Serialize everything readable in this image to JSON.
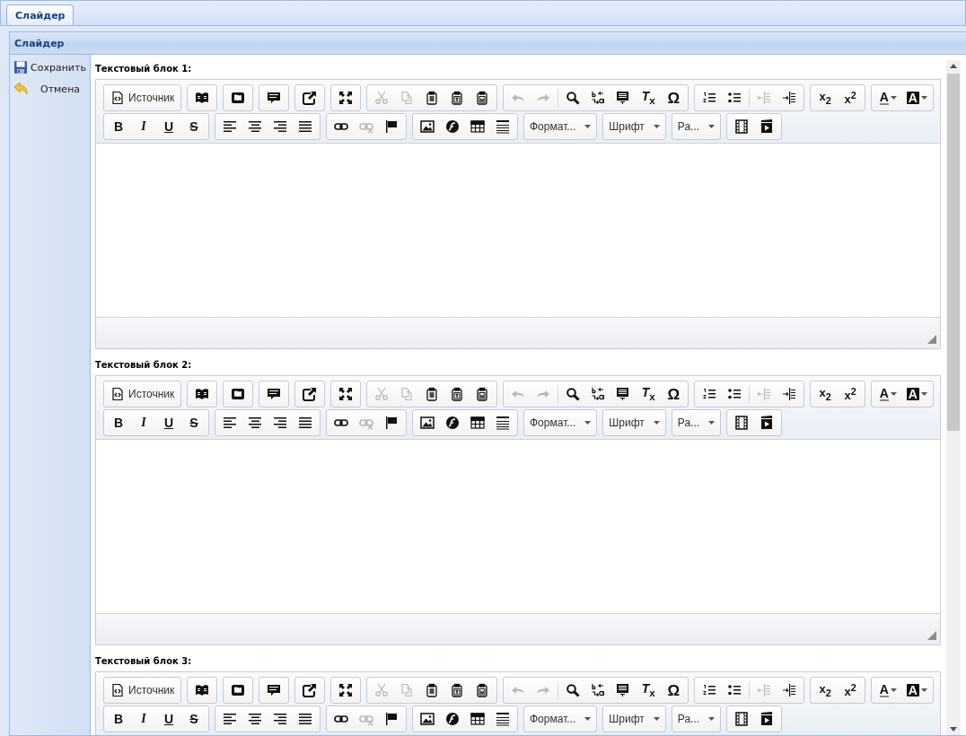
{
  "tabs": [
    {
      "label": "Слайдер",
      "selected": true
    }
  ],
  "panel": {
    "title": "Слайдер"
  },
  "actions": [
    {
      "kind": "save",
      "label": "Сохранить"
    },
    {
      "kind": "cancel",
      "label": "Отмена"
    }
  ],
  "editors": [
    {
      "label": "Текстовый блок 1:",
      "toolbar": [
        [
          {
            "sections": [
              [
                {
                  "kind": "source",
                  "disabled": false,
                  "label": "Источник"
                }
              ]
            ]
          },
          {
            "sections": [
              [
                {
                  "kind": "templates",
                  "disabled": false
                }
              ]
            ]
          },
          {
            "sections": [
              [
                {
                  "kind": "showblocks",
                  "disabled": false
                }
              ]
            ]
          },
          {
            "sections": [
              [
                {
                  "kind": "comment",
                  "disabled": false
                }
              ]
            ]
          },
          {
            "sections": [
              [
                {
                  "kind": "preview",
                  "disabled": false
                }
              ]
            ]
          },
          {
            "sections": [
              [
                {
                  "kind": "maximize",
                  "disabled": false
                }
              ]
            ]
          },
          {
            "sections": [
              [
                {
                  "kind": "cut",
                  "disabled": true
                },
                {
                  "kind": "copy",
                  "disabled": true
                },
                {
                  "kind": "paste",
                  "disabled": false
                },
                {
                  "kind": "pastetext",
                  "disabled": false
                },
                {
                  "kind": "pasteword",
                  "disabled": false
                }
              ]
            ]
          },
          {
            "sections": [
              [
                {
                  "kind": "undo",
                  "disabled": true
                },
                {
                  "kind": "redo",
                  "disabled": true
                }
              ],
              [
                {
                  "kind": "find",
                  "disabled": false
                },
                {
                  "kind": "replace",
                  "disabled": false
                },
                {
                  "kind": "selectall",
                  "disabled": false
                },
                {
                  "kind": "removeformat",
                  "disabled": false,
                  "label": "*T*$_{x}$"
                },
                {
                  "kind": "specialchar",
                  "disabled": false,
                  "label": "Ω"
                }
              ]
            ]
          },
          {
            "sections": [
              [
                {
                  "kind": "numlist",
                  "disabled": false
                },
                {
                  "kind": "bullist",
                  "disabled": false
                }
              ],
              [
                {
                  "kind": "outdent",
                  "disabled": true
                },
                {
                  "kind": "indent",
                  "disabled": false
                }
              ]
            ]
          },
          {
            "sections": [
              [
                {
                  "kind": "subscript",
                  "disabled": false,
                  "label": "x$_{2}$"
                },
                {
                  "kind": "superscript",
                  "disabled": false,
                  "label": "x$^{2}$"
                }
              ]
            ]
          },
          {
            "sections": [
              [
                {
                  "kind": "textcolor",
                  "disabled": false,
                  "label": "A"
                },
                {
                  "kind": "bgcolor",
                  "disabled": false,
                  "label": "A"
                }
              ]
            ]
          }
        ],
        [
          {
            "sections": [
              [
                {
                  "kind": "bold",
                  "disabled": false,
                  "label": "B"
                },
                {
                  "kind": "italic",
                  "disabled": false,
                  "label": "I"
                },
                {
                  "kind": "underline",
                  "disabled": false,
                  "label": "U"
                },
                {
                  "kind": "strike",
                  "disabled": false,
                  "label": "S"
                }
              ]
            ]
          },
          {
            "sections": [
              [
                {
                  "kind": "alignleft",
                  "disabled": false
                },
                {
                  "kind": "aligncenter",
                  "disabled": false
                },
                {
                  "kind": "alignright",
                  "disabled": false
                },
                {
                  "kind": "justify",
                  "disabled": false
                }
              ]
            ]
          },
          {
            "sections": [
              [
                {
                  "kind": "link",
                  "disabled": false
                },
                {
                  "kind": "unlink",
                  "disabled": true
                },
                {
                  "kind": "anchor",
                  "disabled": false
                }
              ]
            ]
          },
          {
            "sections": [
              [
                {
                  "kind": "image",
                  "disabled": false
                },
                {
                  "kind": "flash",
                  "disabled": false
                },
                {
                  "kind": "table",
                  "disabled": false
                },
                {
                  "kind": "hline",
                  "disabled": false
                }
              ]
            ]
          },
          {
            "sections": [
              [
                {
                  "kind": "combo",
                  "label": "Формат..."
                }
              ]
            ]
          },
          {
            "sections": [
              [
                {
                  "kind": "combo",
                  "label": "Шрифт"
                }
              ]
            ]
          },
          {
            "sections": [
              [
                {
                  "kind": "combo",
                  "label": "Ра..."
                }
              ]
            ]
          },
          {
            "sections": [
              [
                {
                  "kind": "film",
                  "disabled": false
                },
                {
                  "kind": "clapper",
                  "disabled": false
                }
              ]
            ]
          }
        ]
      ]
    },
    {
      "label": "Текстовый блок 2:",
      "toolbar": [
        [
          {
            "sections": [
              [
                {
                  "kind": "source",
                  "disabled": false,
                  "label": "Источник"
                }
              ]
            ]
          },
          {
            "sections": [
              [
                {
                  "kind": "templates",
                  "disabled": false
                }
              ]
            ]
          },
          {
            "sections": [
              [
                {
                  "kind": "showblocks",
                  "disabled": false
                }
              ]
            ]
          },
          {
            "sections": [
              [
                {
                  "kind": "comment",
                  "disabled": false
                }
              ]
            ]
          },
          {
            "sections": [
              [
                {
                  "kind": "preview",
                  "disabled": false
                }
              ]
            ]
          },
          {
            "sections": [
              [
                {
                  "kind": "maximize",
                  "disabled": false
                }
              ]
            ]
          },
          {
            "sections": [
              [
                {
                  "kind": "cut",
                  "disabled": true
                },
                {
                  "kind": "copy",
                  "disabled": true
                },
                {
                  "kind": "paste",
                  "disabled": false
                },
                {
                  "kind": "pastetext",
                  "disabled": false
                },
                {
                  "kind": "pasteword",
                  "disabled": false
                }
              ]
            ]
          },
          {
            "sections": [
              [
                {
                  "kind": "undo",
                  "disabled": true
                },
                {
                  "kind": "redo",
                  "disabled": true
                }
              ],
              [
                {
                  "kind": "find",
                  "disabled": false
                },
                {
                  "kind": "replace",
                  "disabled": false
                },
                {
                  "kind": "selectall",
                  "disabled": false
                },
                {
                  "kind": "removeformat",
                  "disabled": false,
                  "label": "*T*$_{x}$"
                },
                {
                  "kind": "specialchar",
                  "disabled": false,
                  "label": "Ω"
                }
              ]
            ]
          },
          {
            "sections": [
              [
                {
                  "kind": "numlist",
                  "disabled": false
                },
                {
                  "kind": "bullist",
                  "disabled": false
                }
              ],
              [
                {
                  "kind": "outdent",
                  "disabled": true
                },
                {
                  "kind": "indent",
                  "disabled": false
                }
              ]
            ]
          },
          {
            "sections": [
              [
                {
                  "kind": "subscript",
                  "disabled": false,
                  "label": "x$_{2}$"
                },
                {
                  "kind": "superscript",
                  "disabled": false,
                  "label": "x$^{2}$"
                }
              ]
            ]
          },
          {
            "sections": [
              [
                {
                  "kind": "textcolor",
                  "disabled": false,
                  "label": "A"
                },
                {
                  "kind": "bgcolor",
                  "disabled": false,
                  "label": "A"
                }
              ]
            ]
          }
        ],
        [
          {
            "sections": [
              [
                {
                  "kind": "bold",
                  "disabled": false,
                  "label": "B"
                },
                {
                  "kind": "italic",
                  "disabled": false,
                  "label": "I"
                },
                {
                  "kind": "underline",
                  "disabled": false,
                  "label": "U"
                },
                {
                  "kind": "strike",
                  "disabled": false,
                  "label": "S"
                }
              ]
            ]
          },
          {
            "sections": [
              [
                {
                  "kind": "alignleft",
                  "disabled": false
                },
                {
                  "kind": "aligncenter",
                  "disabled": false
                },
                {
                  "kind": "alignright",
                  "disabled": false
                },
                {
                  "kind": "justify",
                  "disabled": false
                }
              ]
            ]
          },
          {
            "sections": [
              [
                {
                  "kind": "link",
                  "disabled": false
                },
                {
                  "kind": "unlink",
                  "disabled": true
                },
                {
                  "kind": "anchor",
                  "disabled": false
                }
              ]
            ]
          },
          {
            "sections": [
              [
                {
                  "kind": "image",
                  "disabled": false
                },
                {
                  "kind": "flash",
                  "disabled": false
                },
                {
                  "kind": "table",
                  "disabled": false
                },
                {
                  "kind": "hline",
                  "disabled": false
                }
              ]
            ]
          },
          {
            "sections": [
              [
                {
                  "kind": "combo",
                  "label": "Формат..."
                }
              ]
            ]
          },
          {
            "sections": [
              [
                {
                  "kind": "combo",
                  "label": "Шрифт"
                }
              ]
            ]
          },
          {
            "sections": [
              [
                {
                  "kind": "combo",
                  "label": "Ра..."
                }
              ]
            ]
          },
          {
            "sections": [
              [
                {
                  "kind": "film",
                  "disabled": false
                },
                {
                  "kind": "clapper",
                  "disabled": false
                }
              ]
            ]
          }
        ]
      ]
    },
    {
      "label": "Текстовый блок 3:",
      "toolbar": [
        [
          {
            "sections": [
              [
                {
                  "kind": "source",
                  "disabled": false,
                  "label": "Источник"
                }
              ]
            ]
          },
          {
            "sections": [
              [
                {
                  "kind": "templates",
                  "disabled": false
                }
              ]
            ]
          },
          {
            "sections": [
              [
                {
                  "kind": "showblocks",
                  "disabled": false
                }
              ]
            ]
          },
          {
            "sections": [
              [
                {
                  "kind": "comment",
                  "disabled": false
                }
              ]
            ]
          },
          {
            "sections": [
              [
                {
                  "kind": "preview",
                  "disabled": false
                }
              ]
            ]
          },
          {
            "sections": [
              [
                {
                  "kind": "maximize",
                  "disabled": false
                }
              ]
            ]
          },
          {
            "sections": [
              [
                {
                  "kind": "cut",
                  "disabled": true
                },
                {
                  "kind": "copy",
                  "disabled": true
                },
                {
                  "kind": "paste",
                  "disabled": false
                },
                {
                  "kind": "pastetext",
                  "disabled": false
                },
                {
                  "kind": "pasteword",
                  "disabled": false
                }
              ]
            ]
          },
          {
            "sections": [
              [
                {
                  "kind": "undo",
                  "disabled": true
                },
                {
                  "kind": "redo",
                  "disabled": true
                }
              ],
              [
                {
                  "kind": "find",
                  "disabled": false
                },
                {
                  "kind": "replace",
                  "disabled": false
                },
                {
                  "kind": "selectall",
                  "disabled": false
                },
                {
                  "kind": "removeformat",
                  "disabled": false,
                  "label": "*T*$_{x}$"
                },
                {
                  "kind": "specialchar",
                  "disabled": false,
                  "label": "Ω"
                }
              ]
            ]
          },
          {
            "sections": [
              [
                {
                  "kind": "numlist",
                  "disabled": false
                },
                {
                  "kind": "bullist",
                  "disabled": false
                }
              ],
              [
                {
                  "kind": "outdent",
                  "disabled": true
                },
                {
                  "kind": "indent",
                  "disabled": false
                }
              ]
            ]
          },
          {
            "sections": [
              [
                {
                  "kind": "subscript",
                  "disabled": false,
                  "label": "x$_{2}$"
                },
                {
                  "kind": "superscript",
                  "disabled": false,
                  "label": "x$^{2}$"
                }
              ]
            ]
          },
          {
            "sections": [
              [
                {
                  "kind": "textcolor",
                  "disabled": false,
                  "label": "A"
                },
                {
                  "kind": "bgcolor",
                  "disabled": false,
                  "label": "A"
                }
              ]
            ]
          }
        ],
        [
          {
            "sections": [
              [
                {
                  "kind": "bold",
                  "disabled": false,
                  "label": "B"
                },
                {
                  "kind": "italic",
                  "disabled": false,
                  "label": "I"
                },
                {
                  "kind": "underline",
                  "disabled": false,
                  "label": "U"
                },
                {
                  "kind": "strike",
                  "disabled": false,
                  "label": "S"
                }
              ]
            ]
          },
          {
            "sections": [
              [
                {
                  "kind": "alignleft",
                  "disabled": false
                },
                {
                  "kind": "aligncenter",
                  "disabled": false
                },
                {
                  "kind": "alignright",
                  "disabled": false
                },
                {
                  "kind": "justify",
                  "disabled": false
                }
              ]
            ]
          },
          {
            "sections": [
              [
                {
                  "kind": "link",
                  "disabled": false
                },
                {
                  "kind": "unlink",
                  "disabled": true
                },
                {
                  "kind": "anchor",
                  "disabled": false
                }
              ]
            ]
          },
          {
            "sections": [
              [
                {
                  "kind": "image",
                  "disabled": false
                },
                {
                  "kind": "flash",
                  "disabled": false
                },
                {
                  "kind": "table",
                  "disabled": false
                },
                {
                  "kind": "hline",
                  "disabled": false
                }
              ]
            ]
          },
          {
            "sections": [
              [
                {
                  "kind": "combo",
                  "label": "Формат..."
                }
              ]
            ]
          },
          {
            "sections": [
              [
                {
                  "kind": "combo",
                  "label": "Шрифт"
                }
              ]
            ]
          },
          {
            "sections": [
              [
                {
                  "kind": "combo",
                  "label": "Ра..."
                }
              ]
            ]
          },
          {
            "sections": [
              [
                {
                  "kind": "film",
                  "disabled": false
                },
                {
                  "kind": "clapper",
                  "disabled": false
                }
              ]
            ]
          }
        ]
      ]
    }
  ]
}
